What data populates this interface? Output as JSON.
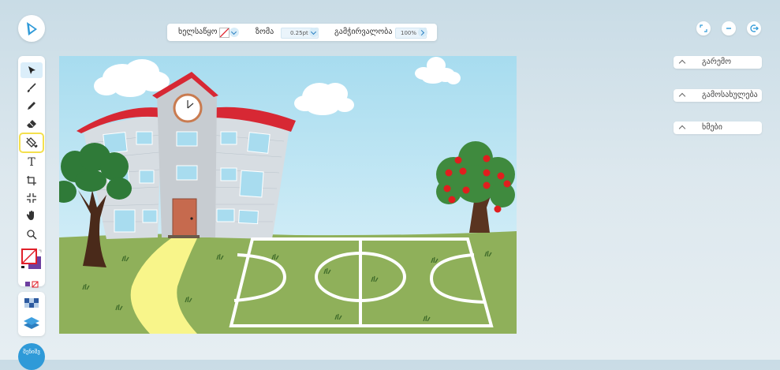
{
  "app": {
    "logo_icon": "app-logo-icon"
  },
  "toolbar": {
    "tool_label": "ხელსაწყო",
    "size_label": "ზომა",
    "size_value": "0.25pt",
    "opacity_label": "გამჭირვალობა",
    "opacity_value": "100%"
  },
  "tools": [
    {
      "name": "select-tool",
      "icon": "cursor-icon",
      "active": true
    },
    {
      "name": "brush-tool",
      "icon": "brush-icon"
    },
    {
      "name": "pen-tool",
      "icon": "pen-icon"
    },
    {
      "name": "eraser-tool",
      "icon": "eraser-icon"
    },
    {
      "name": "fill-tool",
      "icon": "paint-bucket-icon",
      "highlighted": true
    },
    {
      "name": "text-tool",
      "icon": "text-icon",
      "glyph": "T"
    },
    {
      "name": "crop-tool",
      "icon": "crop-icon"
    },
    {
      "name": "shrink-tool",
      "icon": "shrink-icon"
    },
    {
      "name": "pan-tool",
      "icon": "hand-icon"
    },
    {
      "name": "zoom-tool",
      "icon": "magnifier-icon"
    }
  ],
  "colors": {
    "stroke": "#e0202a",
    "fill": "#6d3fa0",
    "accent": "#2f9ad8"
  },
  "user": {
    "label": "შენიშვ"
  },
  "window_controls": [
    "expand-icon",
    "minimize-icon",
    "exit-icon"
  ],
  "panels": [
    {
      "label": "გარემო"
    },
    {
      "label": "გამოსახულება"
    },
    {
      "label": "ხმები"
    }
  ]
}
